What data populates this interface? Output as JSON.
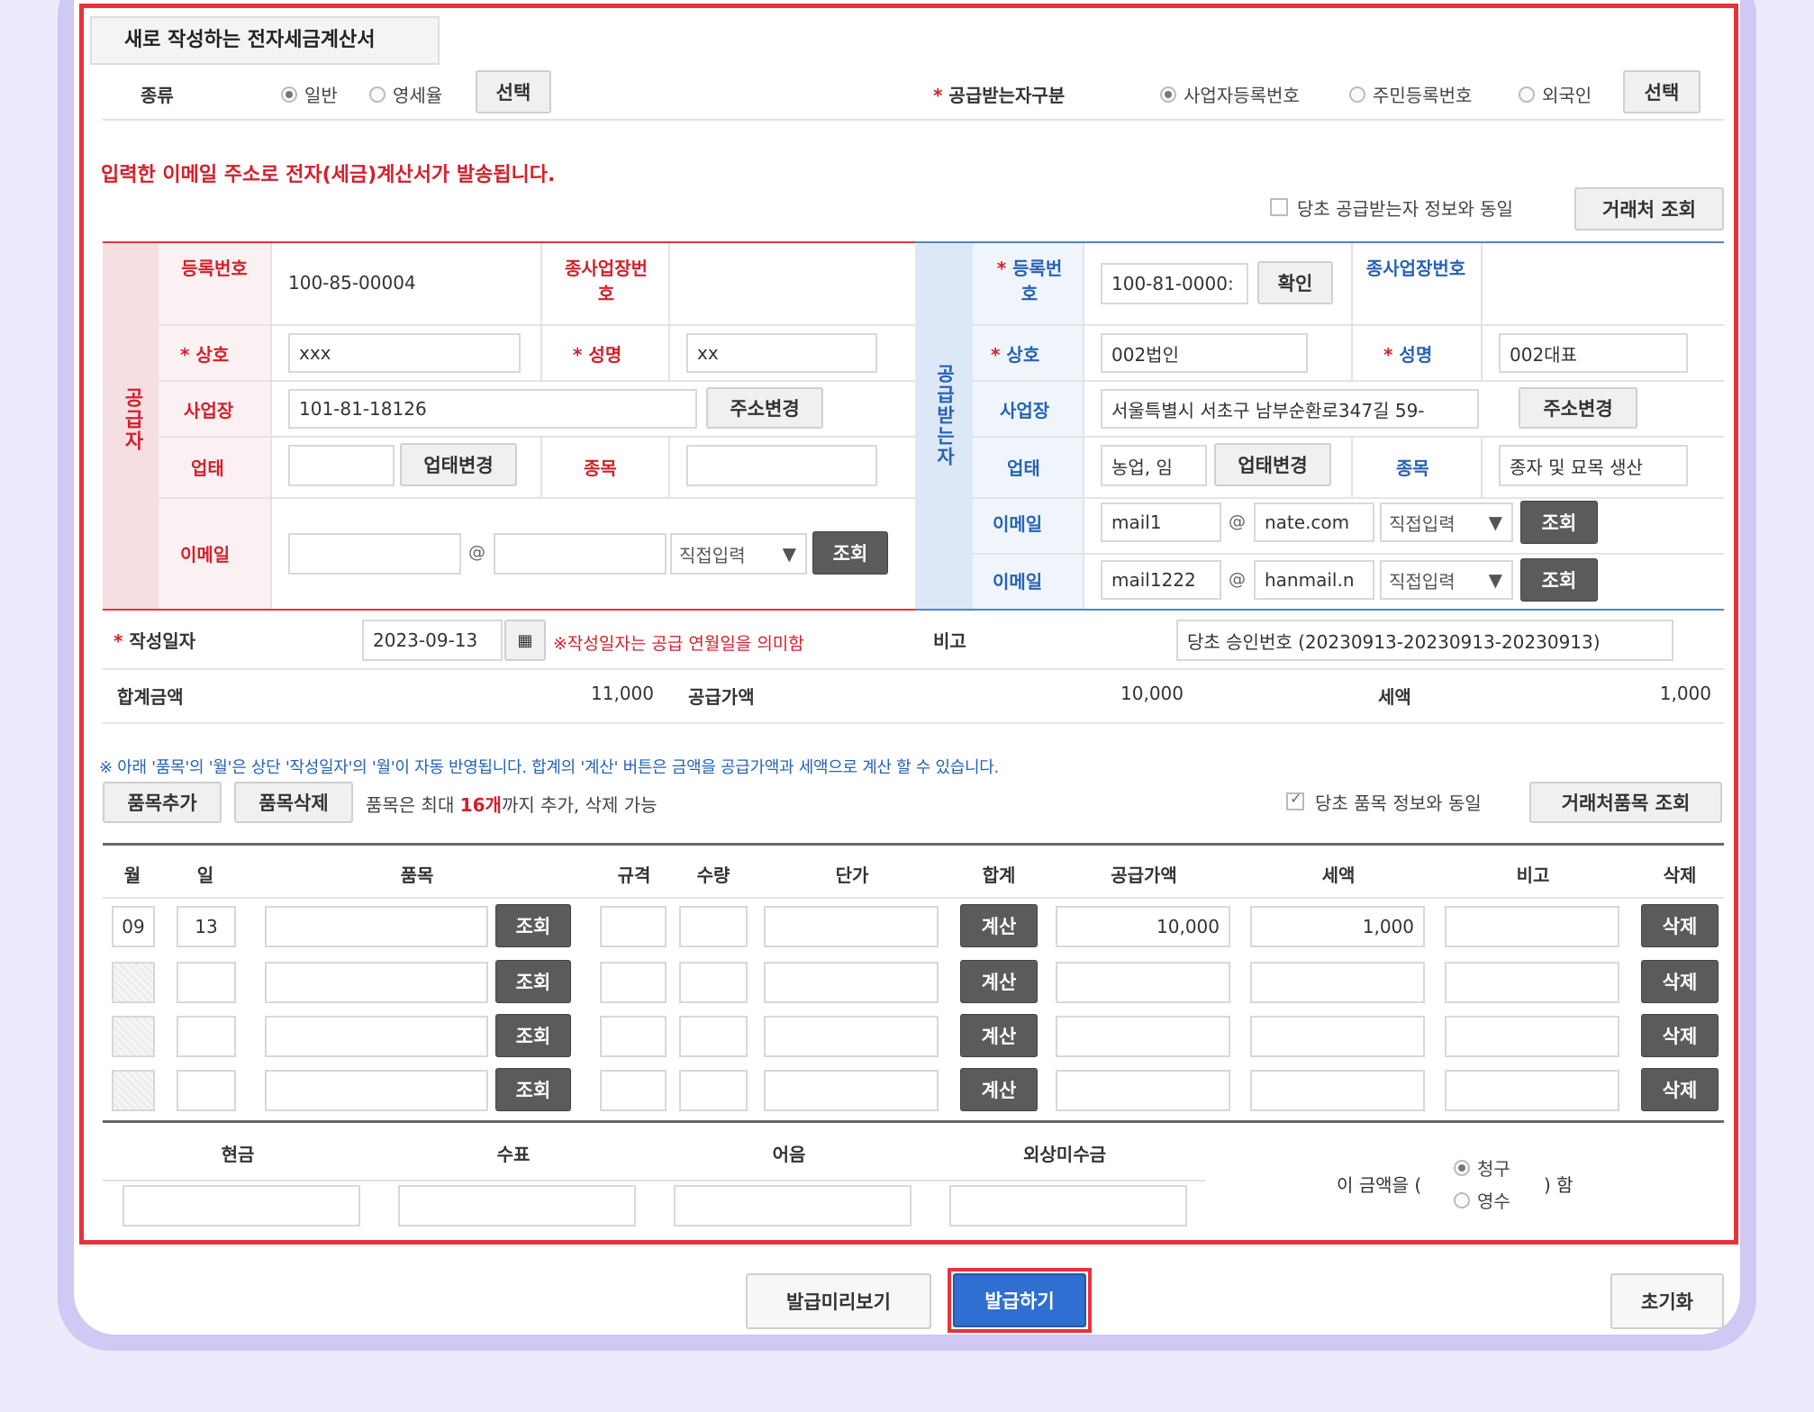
{
  "title": "새로 작성하는 전자세금계산서",
  "kind": {
    "label": "종류",
    "options": [
      "일반",
      "영세율"
    ],
    "selected": "일반",
    "select_btn": "선택"
  },
  "recipient_type": {
    "label": "공급받는자구분",
    "options": [
      "사업자등록번호",
      "주민등록번호",
      "외국인"
    ],
    "selected": "사업자등록번호",
    "select_btn": "선택"
  },
  "notice": "입력한 이메일 주소로 전자(세금)계산서가 발송됩니다.",
  "same_recipient": {
    "label": "당초 공급받는자 정보와 동일",
    "button": "거래처 조회"
  },
  "supplier": {
    "side_label": "공급자",
    "reg_no_label": "등록번호",
    "reg_no": "100-85-00004",
    "branch_label": "종사업장번호",
    "name_label": "상호",
    "name": "xxx",
    "ceo_label": "성명",
    "ceo": "xx",
    "address_label": "사업장",
    "address": "101-81-18126",
    "address_btn": "주소변경",
    "type_label": "업태",
    "type_btn": "업태변경",
    "item_label": "종목",
    "email_label": "이메일",
    "email_domain_select": "직접입력",
    "email_btn": "조회"
  },
  "buyer": {
    "side_label": "공급받는자",
    "reg_no_label": "등록번호",
    "reg_no": "100-81-0000:",
    "reg_confirm": "확인",
    "branch_label": "종사업장번호",
    "name_label": "상호",
    "name": "002법인",
    "ceo_label": "성명",
    "ceo": "002대표",
    "address_label": "사업장",
    "address": "서울특별시 서초구 남부순환로347길 59-",
    "address_btn": "주소변경",
    "type_label": "업태",
    "type": "농업, 임",
    "type_btn": "업태변경",
    "item_label": "종목",
    "item": "종자 및 묘목 생산",
    "email_label": "이메일",
    "email1_user": "mail1",
    "email1_domain": "nate.com",
    "email2_user": "mail1222",
    "email2_domain": "hanmail.n",
    "email_domain_select": "직접입력",
    "email_btn": "조회"
  },
  "date": {
    "label": "작성일자",
    "value": "2023-09-13",
    "note": "※작성일자는 공급 연월일을 의미함"
  },
  "remark": {
    "label": "비고",
    "value": "당초 승인번호 (20230913-20230913-20230913)"
  },
  "totals": {
    "total_label": "합계금액",
    "total": "11,000",
    "supply_label": "공급가액",
    "supply": "10,000",
    "tax_label": "세액",
    "tax": "1,000"
  },
  "items_notice": "※ 아래 '품목'의 '월'은 상단 '작성일자'의 '월'이 자동 반영됩니다. 합계의 '계산' 버튼은 금액을 공급가액과 세액으로 계산 할 수 있습니다.",
  "items_toolbar": {
    "add": "품목추가",
    "delete": "품목삭제",
    "limit_pre": "품목은 최대 ",
    "limit_num": "16개",
    "limit_post": "까지 추가, 삭제 가능",
    "same_items": "당초 품목 정보와 동일",
    "lookup": "거래처품목 조회"
  },
  "item_headers": [
    "월",
    "일",
    "품목",
    "규격",
    "수량",
    "단가",
    "합계",
    "공급가액",
    "세액",
    "비고",
    "삭제"
  ],
  "item_rows": [
    {
      "month": "09",
      "day": "13",
      "supply": "10,000",
      "tax": "1,000"
    },
    {
      "month": "",
      "day": "",
      "supply": "",
      "tax": ""
    },
    {
      "month": "",
      "day": "",
      "supply": "",
      "tax": ""
    },
    {
      "month": "",
      "day": "",
      "supply": "",
      "tax": ""
    }
  ],
  "row_buttons": {
    "lookup": "조회",
    "calc": "계산",
    "delete": "삭제"
  },
  "payment": {
    "headers": [
      "현금",
      "수표",
      "어음",
      "외상미수금"
    ],
    "amount_pre": "이 금액을 (",
    "amount_post": ") 함",
    "options": [
      "청구",
      "영수"
    ],
    "selected": "청구"
  },
  "footer": {
    "preview": "발급미리보기",
    "issue": "발급하기",
    "reset": "초기화"
  },
  "colors": {
    "accent_red": "#e8323c",
    "issue_blue": "#2f6fd1",
    "label_red": "#d51f2a",
    "label_blue": "#2762b6"
  }
}
